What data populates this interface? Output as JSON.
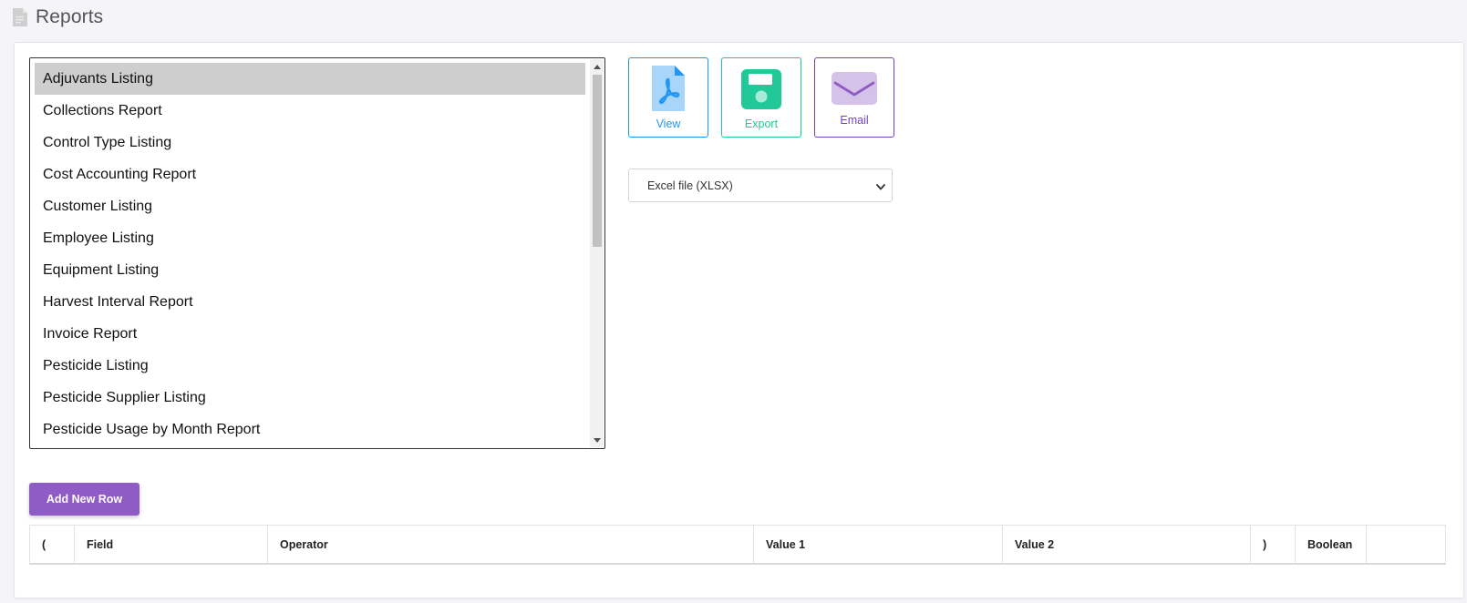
{
  "header": {
    "title": "Reports",
    "icon": "document-icon"
  },
  "report_list": {
    "selected_index": 0,
    "items": [
      "Adjuvants Listing",
      "Collections Report",
      "Control Type Listing",
      "Cost Accounting Report",
      "Customer Listing",
      "Employee Listing",
      "Equipment Listing",
      "Harvest Interval Report",
      "Invoice Report",
      "Pesticide Listing",
      "Pesticide Supplier Listing",
      "Pesticide Usage by Month Report"
    ]
  },
  "actions": {
    "view": {
      "label": "View",
      "icon": "pdf-file-icon",
      "color": "#2196f3"
    },
    "export": {
      "label": "Export",
      "icon": "floppy-disk-icon",
      "color": "#20c997"
    },
    "email": {
      "label": "Email",
      "icon": "envelope-icon",
      "color": "#6f42c1"
    }
  },
  "export_format": {
    "selected": "Excel file (XLSX)"
  },
  "add_row": {
    "label": "Add New Row",
    "color": "#8e5cc4"
  },
  "criteria_table": {
    "columns": [
      "(",
      "Field",
      "Operator",
      "Value 1",
      "Value 2",
      ")",
      "Boolean",
      ""
    ]
  }
}
